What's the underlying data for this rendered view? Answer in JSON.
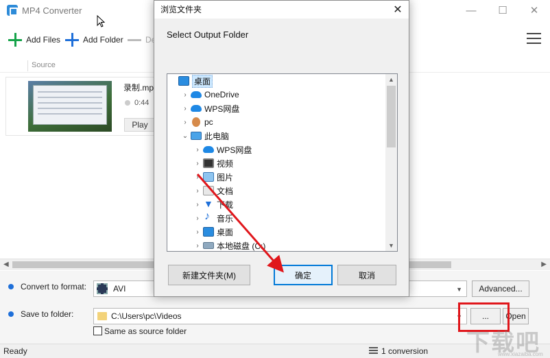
{
  "app": {
    "title": "MP4 Converter"
  },
  "window_controls": {
    "minimize": "—",
    "maximize": "☐",
    "close": "✕"
  },
  "toolbar": {
    "add_files": "Add Files",
    "add_folder": "Add Folder",
    "delete_partial": "De"
  },
  "list": {
    "column_source": "Source"
  },
  "file": {
    "name": "录制.mp",
    "duration": "0:44",
    "play_label": "Play"
  },
  "settings": {
    "convert_label": "Convert to format:",
    "format_value": "AVI",
    "advanced_label": "Advanced...",
    "save_label": "Save to folder:",
    "folder_path": "C:\\Users\\pc\\Videos",
    "browse_label": "...",
    "open_label": "Open",
    "same_source_label": "Same as source folder",
    "same_source_checked": false
  },
  "statusbar": {
    "status": "Ready",
    "conversion_count": "1 conversion"
  },
  "dialog": {
    "title": "浏览文件夹",
    "close": "✕",
    "prompt": "Select Output Folder",
    "tree": [
      {
        "label": "桌面",
        "icon": "desktop-icon",
        "depth": 0,
        "expander": "",
        "selected": true
      },
      {
        "label": "OneDrive",
        "icon": "cloud-icon",
        "depth": 1,
        "expander": "›",
        "selected": false
      },
      {
        "label": "WPS网盘",
        "icon": "cloud-icon",
        "depth": 1,
        "expander": "›",
        "selected": false
      },
      {
        "label": "pc",
        "icon": "user-icon",
        "depth": 1,
        "expander": "›",
        "selected": false
      },
      {
        "label": "此电脑",
        "icon": "computer-icon",
        "depth": 1,
        "expander": "⌄",
        "selected": false
      },
      {
        "label": "WPS网盘",
        "icon": "cloud-icon",
        "depth": 2,
        "expander": "›",
        "selected": false
      },
      {
        "label": "视频",
        "icon": "video-folder-icon",
        "depth": 2,
        "expander": "›",
        "selected": false
      },
      {
        "label": "图片",
        "icon": "pictures-folder-icon",
        "depth": 2,
        "expander": "›",
        "selected": false
      },
      {
        "label": "文档",
        "icon": "documents-folder-icon",
        "depth": 2,
        "expander": "›",
        "selected": false
      },
      {
        "label": "下载",
        "icon": "download-icon",
        "depth": 2,
        "expander": "›",
        "selected": false
      },
      {
        "label": "音乐",
        "icon": "music-icon",
        "depth": 2,
        "expander": "›",
        "selected": false
      },
      {
        "label": "桌面",
        "icon": "desktop-icon",
        "depth": 2,
        "expander": "›",
        "selected": false
      },
      {
        "label": "本地磁盘 (C:)",
        "icon": "disk-icon",
        "depth": 2,
        "expander": "›",
        "selected": false
      }
    ],
    "new_folder_label": "新建文件夹(M)",
    "ok_label": "确定",
    "cancel_label": "取消"
  },
  "watermark": {
    "text": "下载吧",
    "url": "www.xiazaiba.com"
  },
  "colors": {
    "accent": "#1e6fd9",
    "add_green": "#16a34a",
    "highlight_red": "#e0161b"
  }
}
